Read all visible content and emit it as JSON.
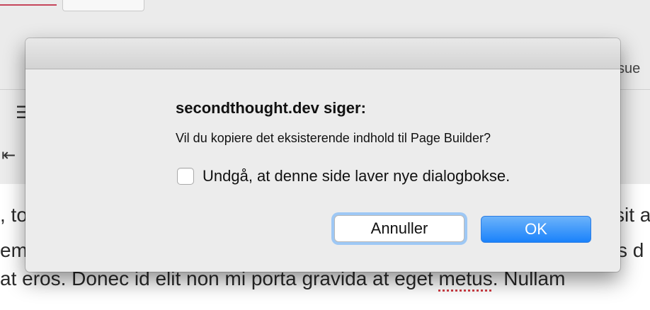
{
  "background": {
    "issue_fragment": "sue",
    "content_lines": [
      {
        "segments": [
          ", to",
          "",
          "sit a"
        ]
      },
      {
        "segments": [
          "emp",
          "",
          "s d"
        ]
      },
      {
        "segments": [
          "at eros. Donec id elit non mi porta gravida at eget ",
          "metus",
          ". Nullam"
        ]
      }
    ]
  },
  "dialog": {
    "heading": "secondthought.dev siger:",
    "message": "Vil du kopiere det eksisterende indhold til Page Builder?",
    "checkbox_label": "Undgå, at denne side laver nye dialogbokse.",
    "checkbox_checked": false,
    "cancel_label": "Annuller",
    "ok_label": "OK"
  },
  "colors": {
    "ok_button": "#1a82fb",
    "focus_ring": "#9ec8f5",
    "spellcheck_underline": "#d0343c"
  }
}
